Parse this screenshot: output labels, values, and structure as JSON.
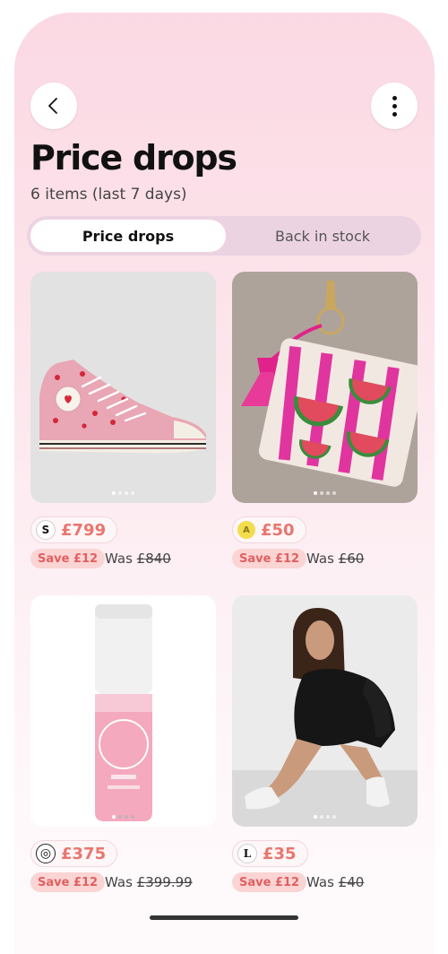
{
  "header": {
    "title": "Price drops",
    "subtitle": "6 items (last 7 days)"
  },
  "tabs": [
    {
      "label": "Price drops",
      "active": true
    },
    {
      "label": "Back in stock",
      "active": false
    }
  ],
  "products": [
    {
      "price": "£799",
      "save": "Save £12",
      "was_label": "Was",
      "was_price": "£840",
      "store_logo_text": "S",
      "store_icon": "store-logo-s",
      "image": "pink-hi-top-sneaker-image"
    },
    {
      "price": "£50",
      "save": "Save £12",
      "was_label": "Was",
      "was_price": "£60",
      "store_logo_text": "A",
      "store_icon": "store-logo-yellow",
      "image": "watermelon-beaded-pouch-image"
    },
    {
      "price": "£375",
      "save": "Save £12",
      "was_label": "Was",
      "was_price": "£399.99",
      "store_logo_text": "◎",
      "store_icon": "store-logo-target",
      "image": "pink-perfume-mist-image"
    },
    {
      "price": "£35",
      "save": "Save £12",
      "was_label": "Was",
      "was_price": "£40",
      "store_logo_text": "L",
      "store_icon": "store-logo-l",
      "image": "black-hoodie-model-image"
    }
  ],
  "colors": {
    "accent_price": "#e8766e",
    "save_badge_bg": "#fbd4d4",
    "save_badge_text": "#e06060",
    "background_top": "#fbd9e4"
  }
}
